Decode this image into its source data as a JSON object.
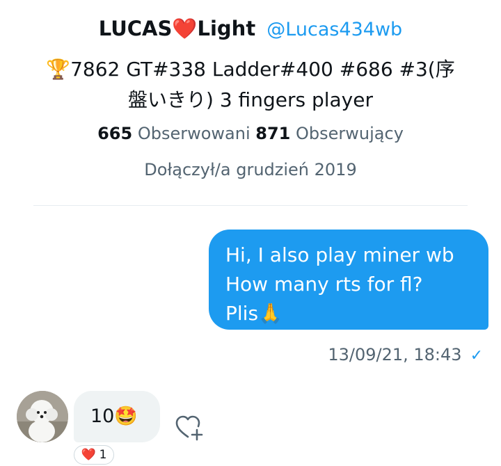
{
  "profile": {
    "display_name_left": "LUCAS",
    "display_name_heart": "❤️",
    "display_name_right": "Light",
    "handle": "@Lucas434wb",
    "bio_line1": "🏆7862 GT#338 Ladder#400 #686 #3(序",
    "bio_line2": "盤いきり) 3 fingers player",
    "following_count": "665",
    "following_label": "Obserwowani",
    "followers_count": "871",
    "followers_label": "Obserwujący",
    "joined": "Dołączył/a grudzień 2019"
  },
  "messages": {
    "outgoing": {
      "lines": [
        "Hi, I also play miner wb",
        "How many rts for fl?",
        "Plis🙏"
      ],
      "timestamp": "13/09/21, 18:43",
      "status_icon": "check-icon"
    },
    "incoming": {
      "text": "10🤩",
      "reaction_emoji": "❤️",
      "reaction_count": "1"
    }
  },
  "icons": {
    "avatar": "white-dog-avatar",
    "add_reaction": "heart-plus-icon"
  },
  "colors": {
    "accent": "#1d9bf0",
    "heart": "#e0245e",
    "muted_text": "#536471",
    "incoming_bubble": "#eff3f4"
  }
}
